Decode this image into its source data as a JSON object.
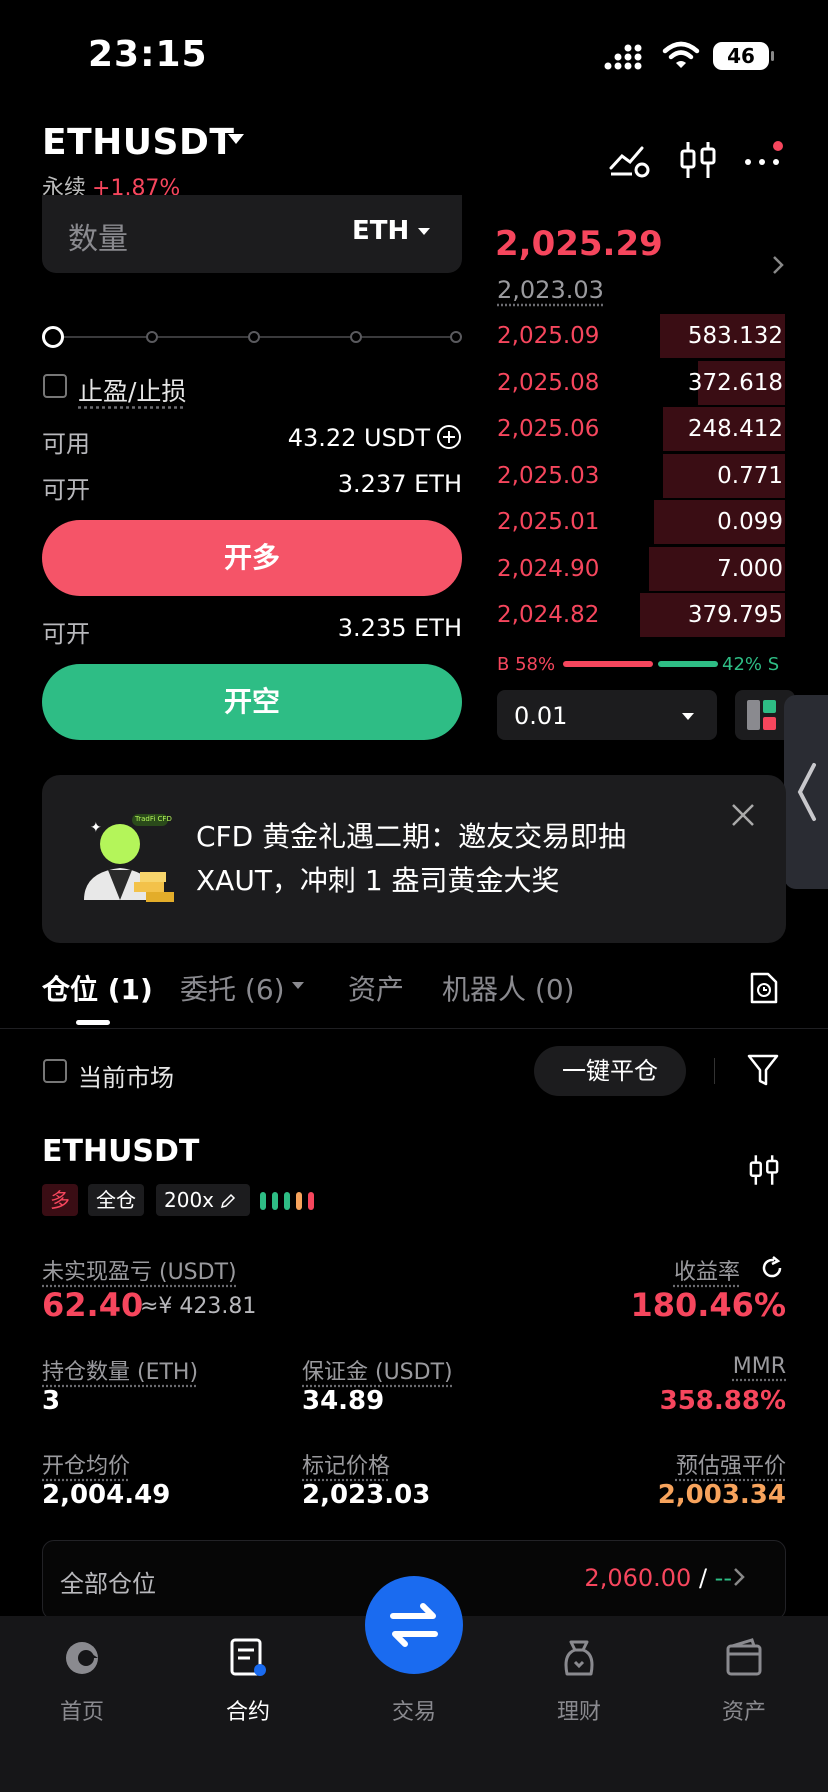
{
  "status": {
    "time": "23:15",
    "battery": "46"
  },
  "header": {
    "pair": "ETHUSDT",
    "type": "永续",
    "change": "+1.87%"
  },
  "form": {
    "qty_label": "数量",
    "qty_unit": "ETH",
    "tpsl_label": "止盈/止损",
    "available_label": "可用",
    "available_value": "43.22 USDT",
    "open_label": "可开",
    "open_long_value": "3.237 ETH",
    "long_button": "开多",
    "open_short_value": "3.235 ETH",
    "short_button": "开空"
  },
  "orderbook": {
    "last_price": "2,025.29",
    "mark_price": "2,023.03",
    "asks": [
      {
        "price": "2,025.09",
        "size": "583.132",
        "depth": 0.43
      },
      {
        "price": "2,025.08",
        "size": "372.618",
        "depth": 0.3
      },
      {
        "price": "2,025.06",
        "size": "248.412",
        "depth": 0.42
      },
      {
        "price": "2,025.03",
        "size": "0.771",
        "depth": 0.42
      },
      {
        "price": "2,025.01",
        "size": "0.099",
        "depth": 0.45
      },
      {
        "price": "2,024.90",
        "size": "7.000",
        "depth": 0.47
      },
      {
        "price": "2,024.82",
        "size": "379.795",
        "depth": 0.5
      }
    ],
    "buy_ratio": "B 58%",
    "sell_ratio": "42% S",
    "precision": "0.01"
  },
  "banner": {
    "text": "CFD 黄金礼遇二期：邀友交易即抽XAUT，冲刺 1 盎司黄金大奖",
    "badge": "TradFi CFD"
  },
  "tabs": [
    {
      "label": "仓位 (1)"
    },
    {
      "label": "委托 (6)"
    },
    {
      "label": "资产"
    },
    {
      "label": "机器人 (0)"
    }
  ],
  "filter": {
    "current_market": "当前市场",
    "close_all": "一键平仓"
  },
  "position": {
    "symbol": "ETHUSDT",
    "side": "多",
    "margin_mode": "全仓",
    "leverage": "200x",
    "upnl_label": "未实现盈亏 (USDT)",
    "upnl_value": "62.40",
    "upnl_cny": "≈¥ 423.81",
    "roe_label": "收益率",
    "roe_value": "180.46%",
    "size_label": "持仓数量 (ETH)",
    "size_value": "3",
    "margin_label": "保证金 (USDT)",
    "margin_value": "34.89",
    "mmr_label": "MMR",
    "mmr_value": "358.88%",
    "entry_label": "开仓均价",
    "entry_value": "2,004.49",
    "markp_label": "标记价格",
    "markp_value": "2,023.03",
    "liq_label": "预估强平价",
    "liq_value": "2,003.34"
  },
  "all_positions": {
    "label": "全部仓位",
    "value": "2,060.00",
    "sep": "/",
    "dash": "--"
  },
  "nav": [
    {
      "label": "首页"
    },
    {
      "label": "合约"
    },
    {
      "label": "交易"
    },
    {
      "label": "理财"
    },
    {
      "label": "资产"
    }
  ],
  "colors": {
    "red": "#f6465d",
    "green": "#2ebd85",
    "blue": "#1a6bf0",
    "orange": "#f7a35c"
  }
}
